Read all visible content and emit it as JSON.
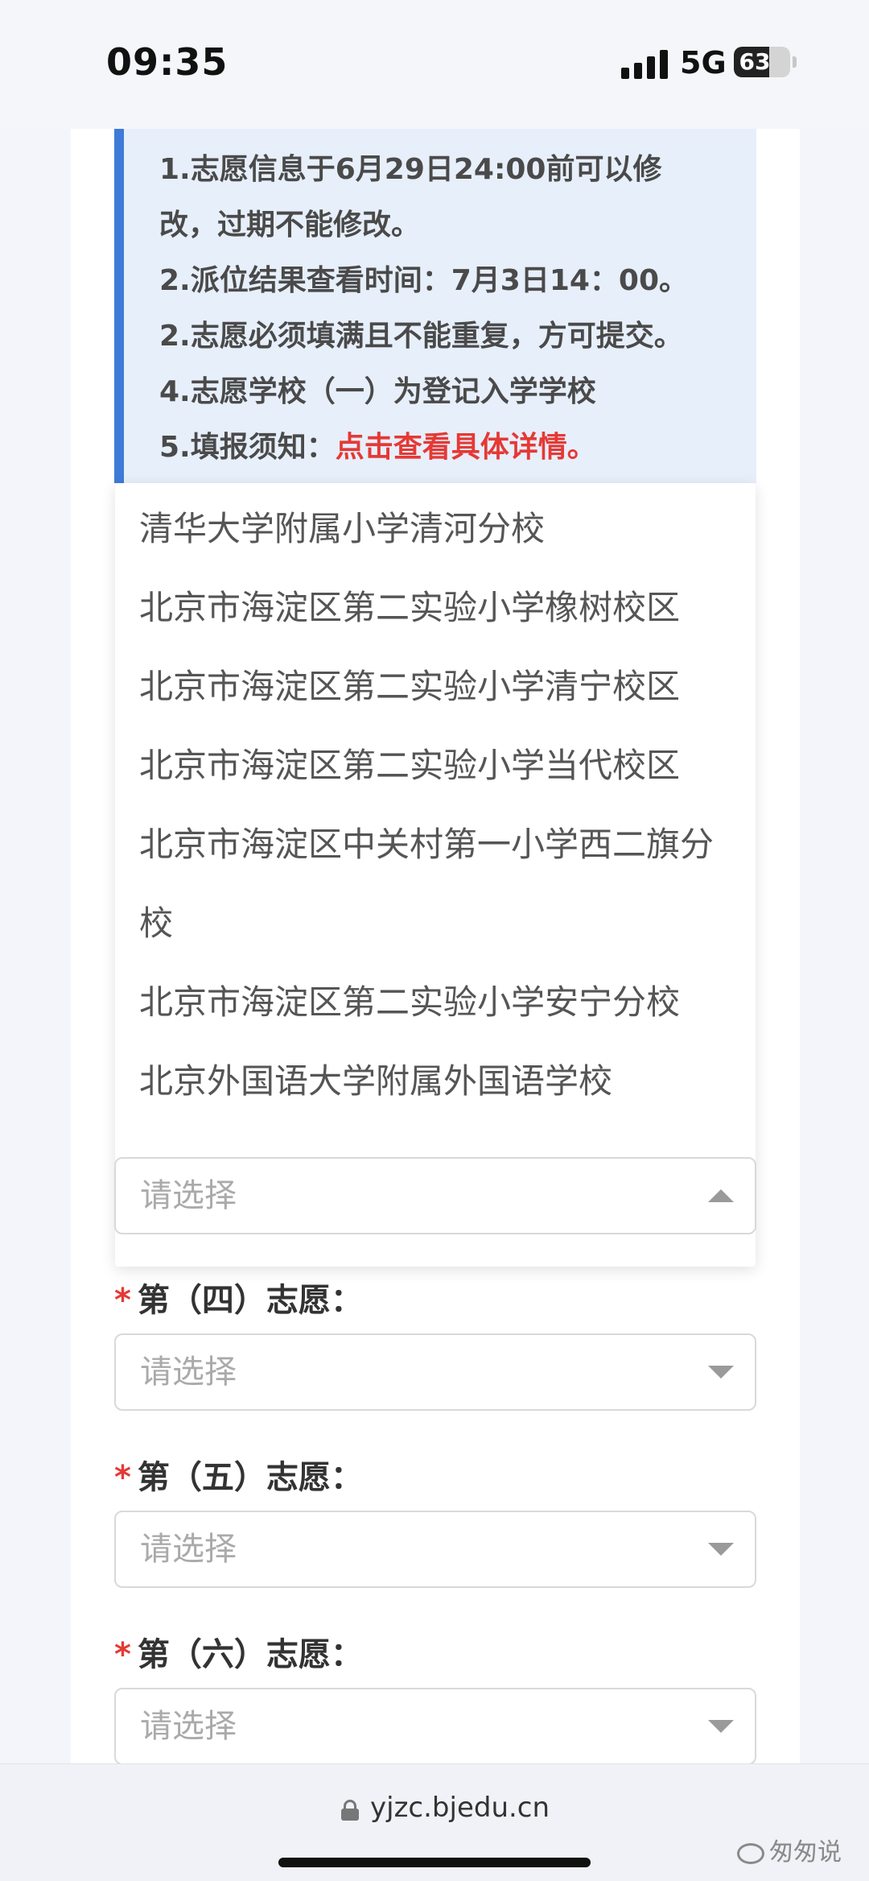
{
  "status_bar": {
    "time": "09:35",
    "network": "5G",
    "battery": 63,
    "battery_text": "63",
    "icons": [
      "signal-icon",
      "battery-icon"
    ]
  },
  "notice": {
    "lines": [
      "1.志愿信息于6月29日24:00前可以修",
      "改，过期不能修改。",
      "2.派位结果查看时间：7月3日14：00。",
      "2.志愿必须填满且不能重复，方可提交。",
      "4.志愿学校（一）为登记入学学校"
    ],
    "last_prefix": "5.填报须知：",
    "link": "点击查看具体详情。"
  },
  "dropdown": {
    "options": [
      "清华大学附属小学清河分校",
      "北京市海淀区第二实验小学橡树校区",
      "北京市海淀区第二实验小学清宁校区",
      "北京市海淀区第二实验小学当代校区",
      "北京市海淀区中关村第一小学西二旗分校",
      "北京市海淀区第二实验小学安宁分校",
      "北京外国语大学附属外国语学校"
    ]
  },
  "fields": {
    "star": "*",
    "placeholder": "请选择",
    "fourth": "第（四）志愿：",
    "fifth": "第（五）志愿：",
    "sixth": "第（六）志愿："
  },
  "browser": {
    "url": "yjzc.bjedu.cn",
    "watermark": "匆匆说"
  },
  "colors": {
    "accent": "#3e7bd8",
    "link": "#e53935",
    "notice_bg": "#e7effb"
  }
}
